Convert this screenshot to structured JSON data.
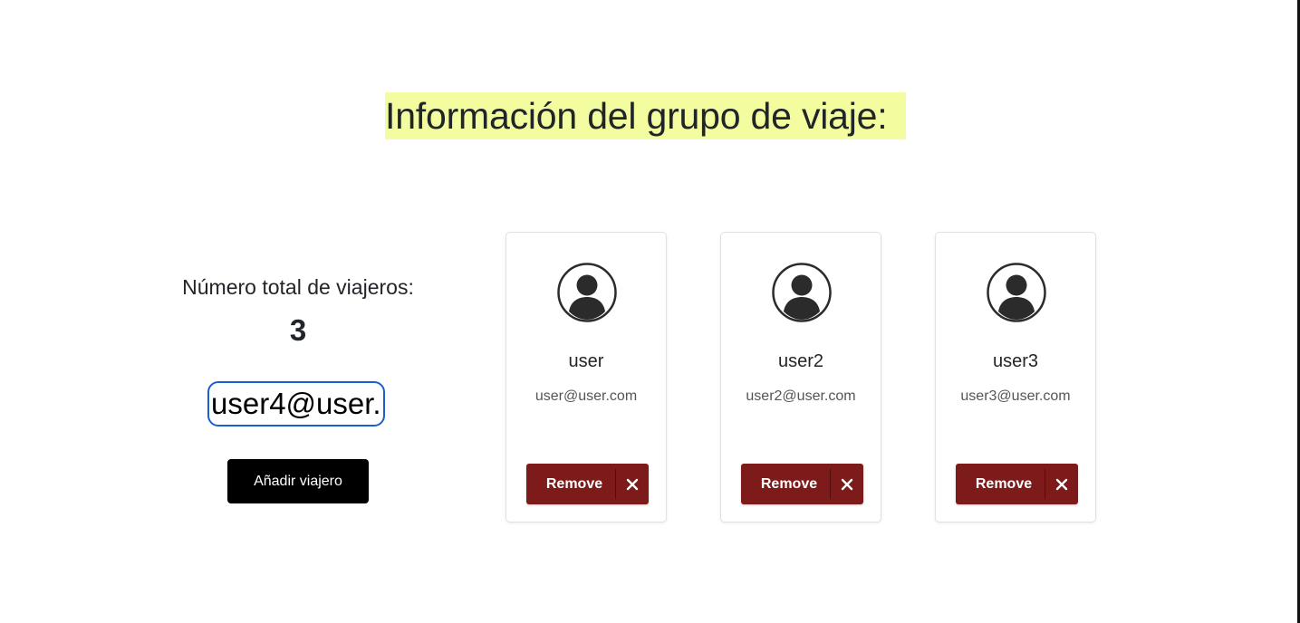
{
  "title": "Información del grupo de viaje:",
  "colors": {
    "title_highlight": "#f3fd9f",
    "remove_button": "#7d1a1a",
    "add_button": "#000000",
    "input_focus_border": "#1a5fd0"
  },
  "travelers_panel": {
    "total_label": "Número total de viajeros:",
    "total_value": "3",
    "email_input_value": "user4@user.",
    "add_button_label": "Añadir viajero"
  },
  "travelers": [
    {
      "name": "user",
      "email": "user@user.com",
      "remove_label": "Remove",
      "avatar_icon": "user-circle-icon",
      "remove_icon": "close-icon"
    },
    {
      "name": "user2",
      "email": "user2@user.com",
      "remove_label": "Remove",
      "avatar_icon": "user-circle-icon",
      "remove_icon": "close-icon"
    },
    {
      "name": "user3",
      "email": "user3@user.com",
      "remove_label": "Remove",
      "avatar_icon": "user-circle-icon",
      "remove_icon": "close-icon"
    }
  ]
}
